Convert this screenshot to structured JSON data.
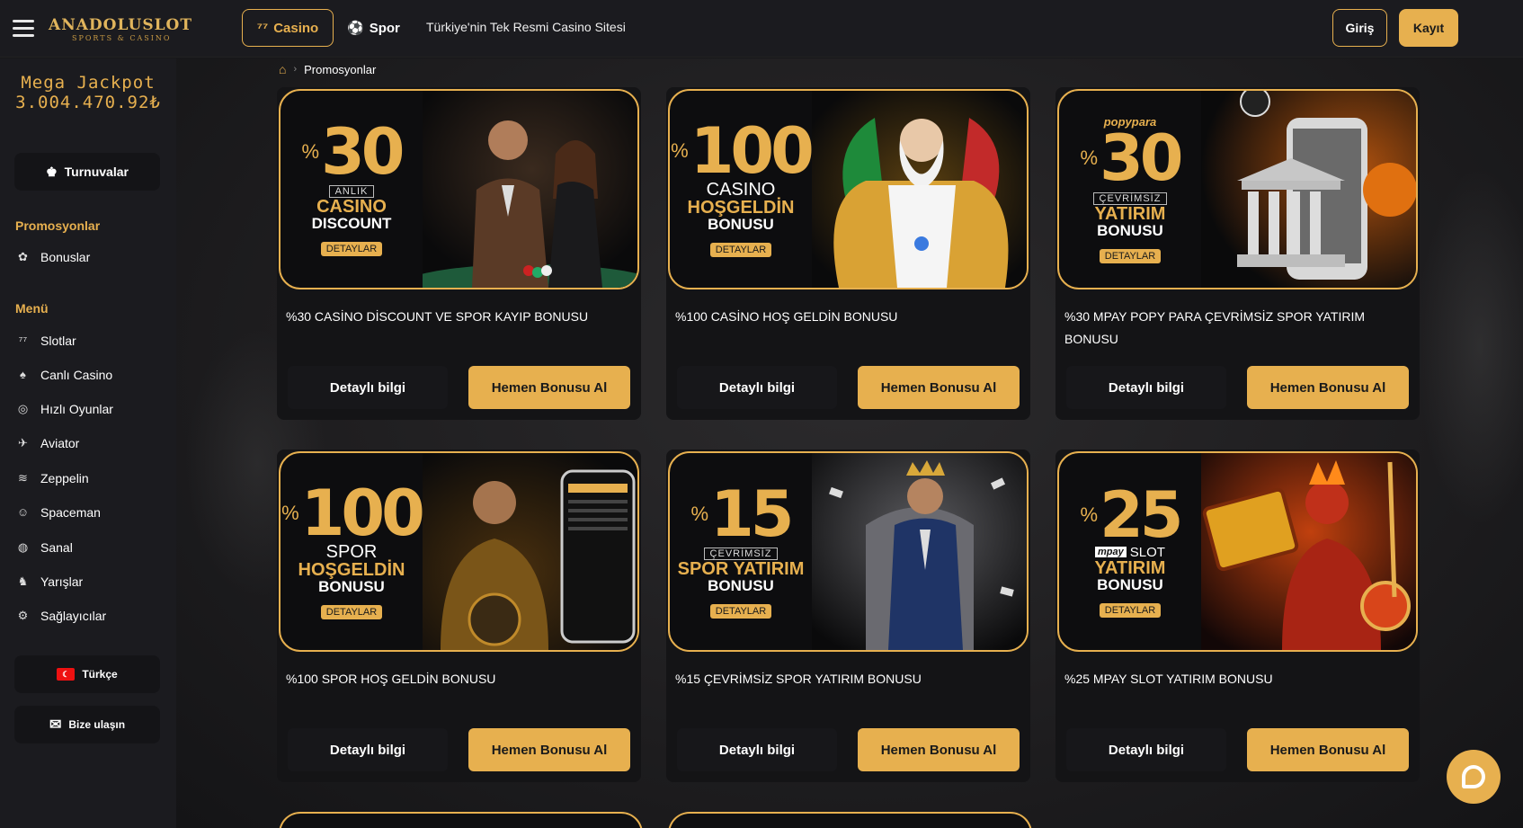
{
  "header": {
    "logo_main": "ANADOLUSLOT",
    "logo_sub": "SPORTS & CASINO",
    "nav_casino": "Casino",
    "nav_spor": "Spor",
    "tagline": "Türkiye'nin Tek Resmi Casino Sitesi",
    "login": "Giriş",
    "register": "Kayıt"
  },
  "sidebar": {
    "jackpot_title": "Mega Jackpot",
    "jackpot_value": "3.004.470.92₺",
    "tournaments": "Turnuvalar",
    "promotions_heading": "Promosyonlar",
    "bonuses": "Bonuslar",
    "menu_heading": "Menü",
    "menu_items": [
      {
        "label": "Slotlar",
        "icon": "slot-icon"
      },
      {
        "label": "Canlı Casino",
        "icon": "spade-icon"
      },
      {
        "label": "Hızlı Oyunlar",
        "icon": "chip-icon"
      },
      {
        "label": "Aviator",
        "icon": "plane-icon"
      },
      {
        "label": "Zeppelin",
        "icon": "zeppelin-icon"
      },
      {
        "label": "Spaceman",
        "icon": "astronaut-icon"
      },
      {
        "label": "Sanal",
        "icon": "globe-icon"
      },
      {
        "label": "Yarışlar",
        "icon": "horse-icon"
      },
      {
        "label": "Sağlayıcılar",
        "icon": "providers-icon"
      }
    ],
    "language": "Türkçe",
    "contact": "Bize ulaşın"
  },
  "breadcrumb": {
    "current": "Promosyonlar"
  },
  "cards": [
    {
      "title": "%30 CASİNO DİSCOUNT VE SPOR KAYIP BONUSU",
      "pct": "30",
      "pct_sign": "%",
      "sub": "ANLIK",
      "line1": "CASINO",
      "line2": "DISCOUNT",
      "tag": "DETAYLAR",
      "details": "Detaylı bilgi",
      "claim": "Hemen Bonusu Al"
    },
    {
      "title": "%100 CASİNO HOŞ GELDİN BONUSU",
      "pct": "100",
      "pct_sign": "%",
      "line1w": "CASINO",
      "line1": "HOŞGELDİN",
      "line2": "BONUSU",
      "tag": "DETAYLAR",
      "details": "Detaylı bilgi",
      "claim": "Hemen Bonusu Al"
    },
    {
      "title": "%30 MPAY POPY PARA ÇEVRİMSİZ SPOR YATIRIM BONUSU",
      "brand": "popypara",
      "pct": "30",
      "pct_sign": "%",
      "sub": "ÇEVRİMSİZ",
      "line1": "YATIRIM",
      "line2": "BONUSU",
      "tag": "DETAYLAR",
      "details": "Detaylı bilgi",
      "claim": "Hemen Bonusu Al"
    },
    {
      "title": "%100 SPOR HOŞ GELDİN BONUSU",
      "pct": "100",
      "pct_sign": "%",
      "line1w": "SPOR",
      "line1": "HOŞGELDİN",
      "line2": "BONUSU",
      "tag": "DETAYLAR",
      "details": "Detaylı bilgi",
      "claim": "Hemen Bonusu Al"
    },
    {
      "title": "%15 ÇEVRİMSİZ SPOR YATIRIM BONUSU",
      "pct": "15",
      "pct_sign": "%",
      "sub": "ÇEVRİMSİZ",
      "line1": "SPOR YATIRIM",
      "line2": "BONUSU",
      "tag": "DETAYLAR",
      "details": "Detaylı bilgi",
      "claim": "Hemen Bonusu Al"
    },
    {
      "title": "%25 MPAY SLOT YATIRIM BONUSU",
      "brand": "mpay",
      "pct": "25",
      "pct_sign": "%",
      "sub": "SLOT",
      "line1": "YATIRIM",
      "line2": "BONUSU",
      "tag": "DETAYLAR",
      "details": "Detaylı bilgi",
      "claim": "Hemen Bonusu Al"
    }
  ],
  "colors": {
    "accent": "#e7b04f",
    "background": "#17171a",
    "panel": "#1b1b1f"
  }
}
